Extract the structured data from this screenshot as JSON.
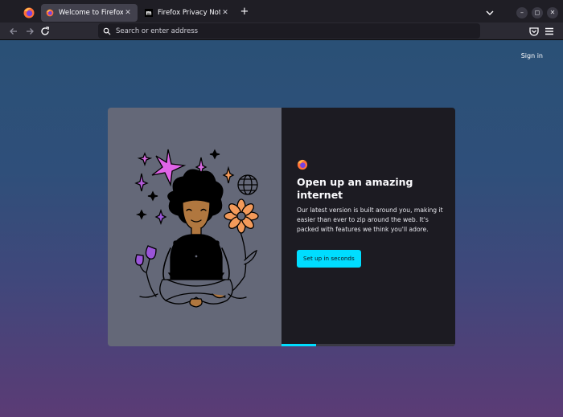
{
  "tabs": [
    {
      "title": "Welcome to Firefox",
      "active": true,
      "close": "✕"
    },
    {
      "title": "Firefox Privacy Notice —",
      "active": false,
      "close": "✕"
    }
  ],
  "new_tab_label": "+",
  "window": {
    "minimize": "–",
    "maximize": "◻",
    "close": "✕"
  },
  "urlbar": {
    "placeholder": "Search or enter address",
    "value": ""
  },
  "page": {
    "sign_in": "Sign in",
    "heading": "Open up an amazing internet",
    "body": "Our latest version is built around you, making it easier than ever to zip around the web. It's packed with features we think you'll adore.",
    "cta": "Set up in seconds",
    "progress": 0.2
  },
  "colors": {
    "accent": "#00ddff",
    "sparkle_pink": "#e064e8",
    "flower_orange": "#f39a5a",
    "skin": "#b0773f"
  }
}
